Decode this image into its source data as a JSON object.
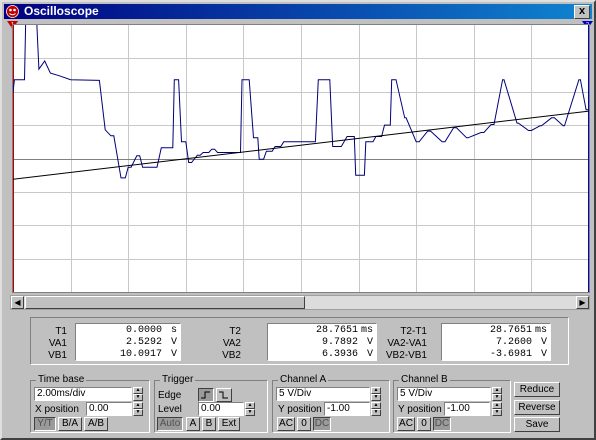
{
  "window": {
    "title": "Oscilloscope",
    "close_label": "x"
  },
  "colors": {
    "channel_a": "#00007a",
    "channel_b": "#000000",
    "screen_bg": "#ffffff",
    "grid": "#c8c8c8",
    "cursor_1": "#c00000",
    "cursor_2": "#0000c0"
  },
  "cursors": {
    "t1_label": "1",
    "t2_label": "2"
  },
  "readouts": {
    "col1": {
      "labels": [
        "T1",
        "VA1",
        "VB1"
      ],
      "values": [
        "0.0000",
        "2.5292",
        "10.0917"
      ],
      "units": [
        "s",
        "V",
        "V"
      ]
    },
    "col2": {
      "labels": [
        "T2",
        "VA2",
        "VB2"
      ],
      "values": [
        "28.7651",
        "9.7892",
        "6.3936"
      ],
      "units": [
        "ms",
        "V",
        "V"
      ]
    },
    "col3": {
      "labels": [
        "T2-T1",
        "VA2-VA1",
        "VB2-VB1"
      ],
      "values": [
        "28.7651",
        "7.2600",
        "-3.6981"
      ],
      "units": [
        "ms",
        "V",
        "V"
      ]
    }
  },
  "timebase": {
    "title": "Time base",
    "value": "2.00ms/div",
    "xpos_label": "X position",
    "xpos": "0.00",
    "modes": [
      "Y/T",
      "B/A",
      "A/B"
    ]
  },
  "trigger": {
    "title": "Trigger",
    "edge_label": "Edge",
    "level_label": "Level",
    "level": "0.00",
    "sources": [
      "Auto",
      "A",
      "B",
      "Ext"
    ]
  },
  "channel_a": {
    "title": "Channel A",
    "value": "5 V/Div",
    "ypos_label": "Y position",
    "ypos": "-1.00",
    "coupling": [
      "AC",
      "0",
      "DC"
    ]
  },
  "channel_b": {
    "title": "Channel B",
    "value": "5 V/Div",
    "ypos_label": "Y position",
    "ypos": "-1.00",
    "coupling": [
      "AC",
      "0",
      "DC"
    ]
  },
  "actions": {
    "reduce": "Reduce",
    "reverse": "Reverse",
    "save": "Save"
  },
  "chart_data": {
    "type": "line",
    "xlabel": "",
    "ylabel": "",
    "grid": true,
    "x_divisions": 10,
    "y_divisions": 8,
    "xlim": [
      0,
      20
    ],
    "ylim": [
      -20,
      20
    ],
    "x_units": "ms",
    "y_units": "V",
    "series": [
      {
        "channel": "A",
        "x": [
          0,
          0.05,
          0.4,
          0.45,
          0.8,
          0.9,
          1.1,
          1.3,
          1.6,
          2,
          3,
          3.1,
          3.2,
          3.4,
          3.5,
          3.7,
          3.75,
          3.9,
          4,
          4.1,
          4.3,
          4.4,
          4.5,
          5,
          5.15,
          5.55,
          5.6,
          5.75,
          5.85,
          6,
          6.1,
          6.2,
          6.4,
          6.5,
          6.6,
          6.8,
          6.9,
          7,
          7.1,
          7.2,
          7.45,
          7.9,
          7.95,
          8.2,
          8.35,
          8.5,
          8.55,
          8.7,
          8.8,
          9,
          9.1,
          9.3,
          9.4,
          9.6,
          9.7,
          9.95,
          10.5,
          10.6,
          11,
          11.1,
          11.4,
          11.6,
          11.85,
          11.9,
          12.2,
          12.25,
          12.5,
          12.6,
          12.8,
          12.9,
          13.1,
          13.15,
          13.3,
          13.6,
          13.65,
          14,
          14.1,
          14.4,
          14.5,
          14.9,
          15,
          15.3,
          15.4,
          15.75,
          15.8,
          16.25,
          16.35,
          16.6,
          16.7,
          17,
          17.05,
          17.5,
          17.55,
          17.9,
          18,
          18.3,
          18.35,
          18.7,
          18.8,
          19.1,
          19.15,
          19.65,
          19.7,
          19.9,
          20
        ],
        "y": [
          9.9,
          11.8,
          11.8,
          22.9,
          22.9,
          13.4,
          14.6,
          12.8,
          12.4,
          11.8,
          11.7,
          8,
          4.3,
          3.4,
          3.4,
          -1.7,
          -2.9,
          -2.9,
          -1.3,
          -1.3,
          0.4,
          0.4,
          -1.3,
          -1.3,
          1.6,
          1.6,
          11.8,
          11.8,
          2.5,
          2.5,
          -0.6,
          -0.6,
          0.5,
          0.5,
          0.9,
          0.9,
          1.4,
          1.4,
          0.9,
          0.9,
          0.9,
          0.9,
          11.8,
          11.8,
          3.1,
          3.1,
          -0.1,
          -0.1,
          1.1,
          1.1,
          1.8,
          1.8,
          2.5,
          2.5,
          2.5,
          2.5,
          2.5,
          11.8,
          11.8,
          1.8,
          1.8,
          3.3,
          3.3,
          -2.5,
          -2.5,
          2.5,
          2.5,
          3.3,
          3.3,
          5,
          5,
          11.8,
          11.8,
          6.1,
          6.1,
          2.5,
          2.5,
          4.1,
          4.1,
          2.5,
          2.5,
          4.6,
          4.6,
          3.1,
          3.1,
          3.9,
          3.9,
          5.1,
          5.1,
          11.8,
          11.8,
          5.3,
          5.3,
          4.2,
          4.2,
          4.9,
          4.9,
          6.1,
          6.1,
          4.9,
          4.9,
          11.8,
          11.8,
          7.3,
          7.3
        ]
      },
      {
        "channel": "B",
        "x": [
          0,
          20
        ],
        "y": [
          -3.1,
          7.1
        ]
      }
    ]
  }
}
